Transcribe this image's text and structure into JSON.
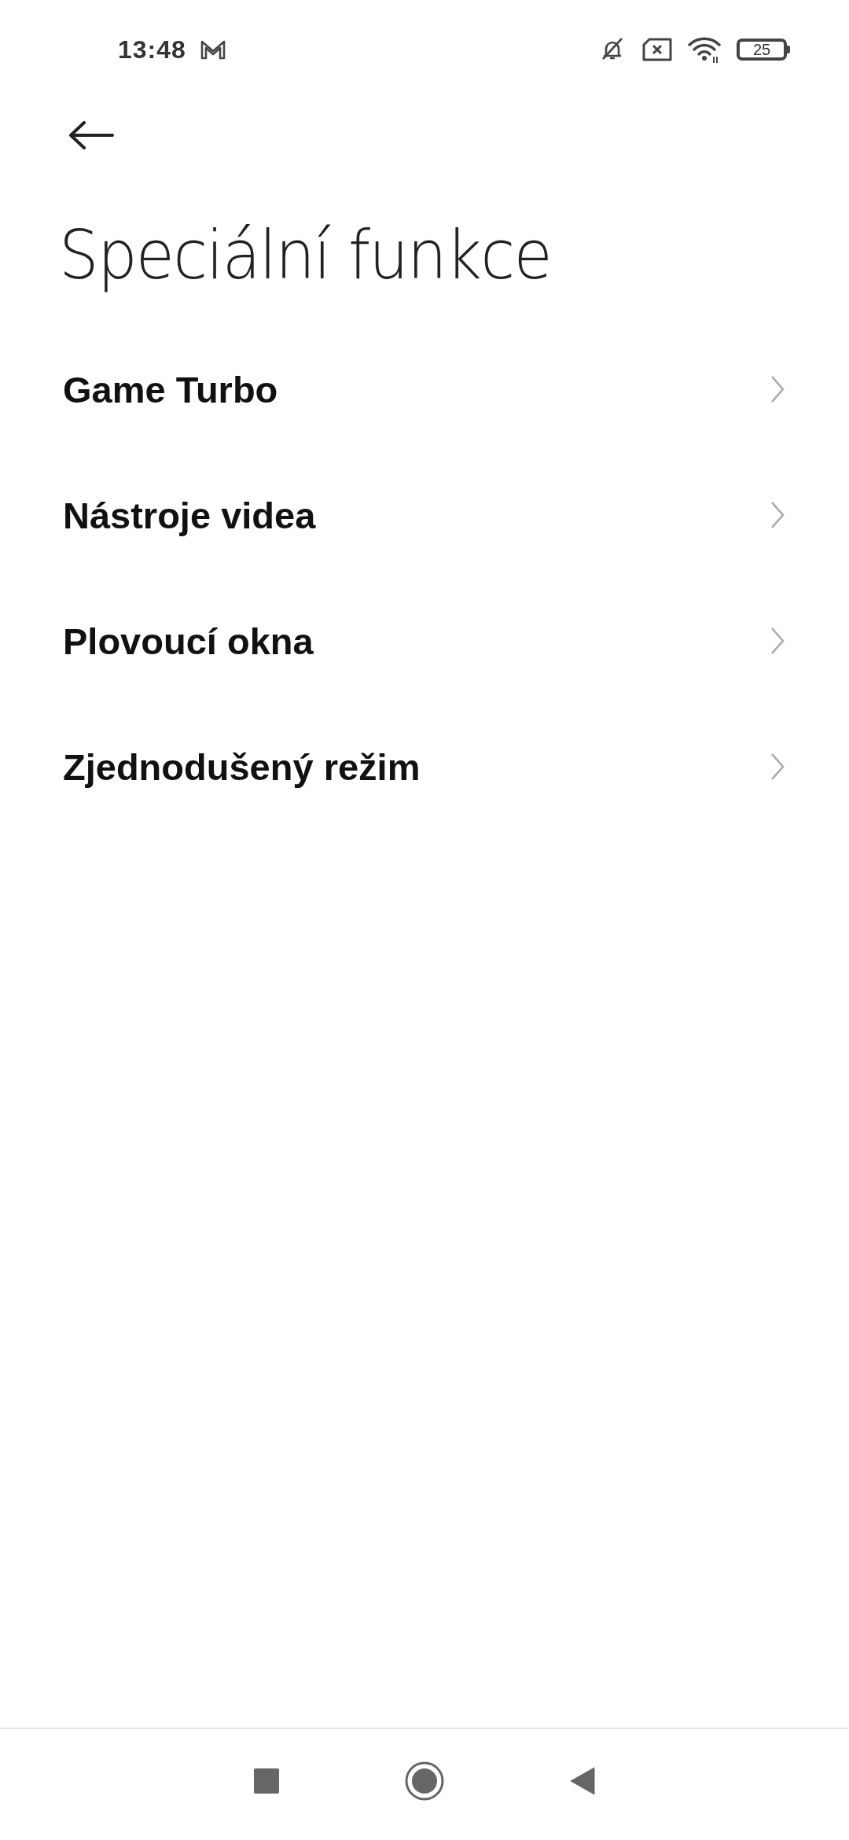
{
  "status_bar": {
    "time": "13:48",
    "battery": "25"
  },
  "title": "Speciální funkce",
  "items": [
    {
      "label": "Game Turbo"
    },
    {
      "label": "Nástroje videa"
    },
    {
      "label": "Plovoucí okna"
    },
    {
      "label": "Zjednodušený režim"
    }
  ]
}
